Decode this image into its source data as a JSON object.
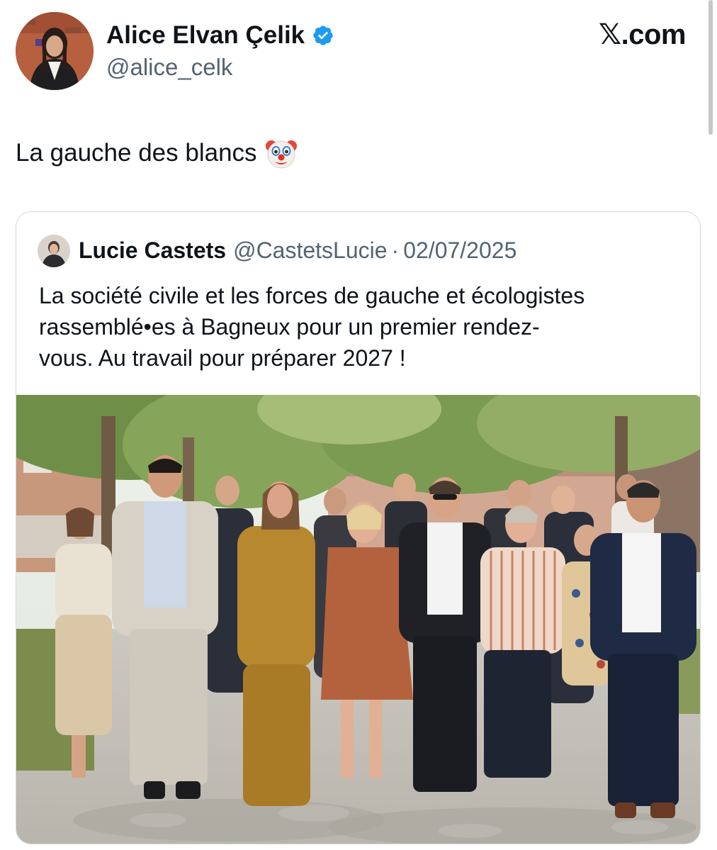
{
  "tweet": {
    "author_name": "Alice Elvan Çelik",
    "author_handle": "@alice_celk",
    "verified": true,
    "text": "La gauche des blancs",
    "emoji_icon": "clown-face-icon"
  },
  "site_badge": "𝕏.com",
  "quoted_tweet": {
    "author_name": "Lucie Castets",
    "author_handle": "@CastetsLucie",
    "separator": "·",
    "date": "02/07/2025",
    "text_lines": [
      "La société civile et les forces de gauche et écologistes",
      "rassemblé•es à Bagneux pour un premier rendez-",
      "vous. Au travail pour préparer 2027 !"
    ],
    "photo": "group-photo-of-people-walking-outdoors"
  },
  "colors": {
    "text_primary": "#0f1419",
    "text_secondary": "#536471",
    "verified_blue": "#1d9bf0",
    "card_border": "#cfd9de"
  }
}
